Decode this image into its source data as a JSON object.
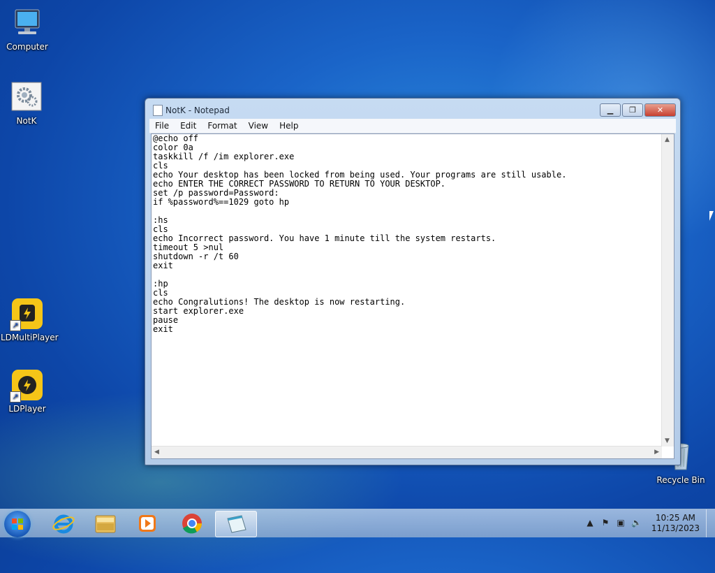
{
  "desktop": {
    "icons": [
      {
        "label": "Computer",
        "icon": "computer-icon"
      },
      {
        "label": "NotK",
        "icon": "batch-file-icon"
      },
      {
        "label": "LDMultiPlayer",
        "icon": "ldmultiplayer-icon"
      },
      {
        "label": "LDPlayer",
        "icon": "ldplayer-icon"
      },
      {
        "label": "Recycle Bin",
        "icon": "recycle-bin-icon"
      }
    ]
  },
  "notepad": {
    "title": "NotK - Notepad",
    "menu": [
      "File",
      "Edit",
      "Format",
      "View",
      "Help"
    ],
    "content": "@echo off\ncolor 0a\ntaskkill /f /im explorer.exe\ncls\necho Your desktop has been locked from being used. Your programs are still usable.\necho ENTER THE CORRECT PASSWORD TO RETURN TO YOUR DESKTOP.\nset /p password=Password:\nif %password%==1029 goto hp\n\n:hs\ncls\necho Incorrect password. You have 1 minute till the system restarts.\ntimeout 5 >nul\nshutdown -r /t 60\nexit\n\n:hp\ncls\necho Congralutions! The desktop is now restarting.\nstart explorer.exe\npause\nexit"
  },
  "taskbar": {
    "pinned": [
      "internet-explorer-icon",
      "file-explorer-icon",
      "media-player-icon",
      "chrome-icon",
      "notepad-icon"
    ],
    "clock": {
      "time": "10:25 AM",
      "date": "11/13/2023"
    }
  }
}
